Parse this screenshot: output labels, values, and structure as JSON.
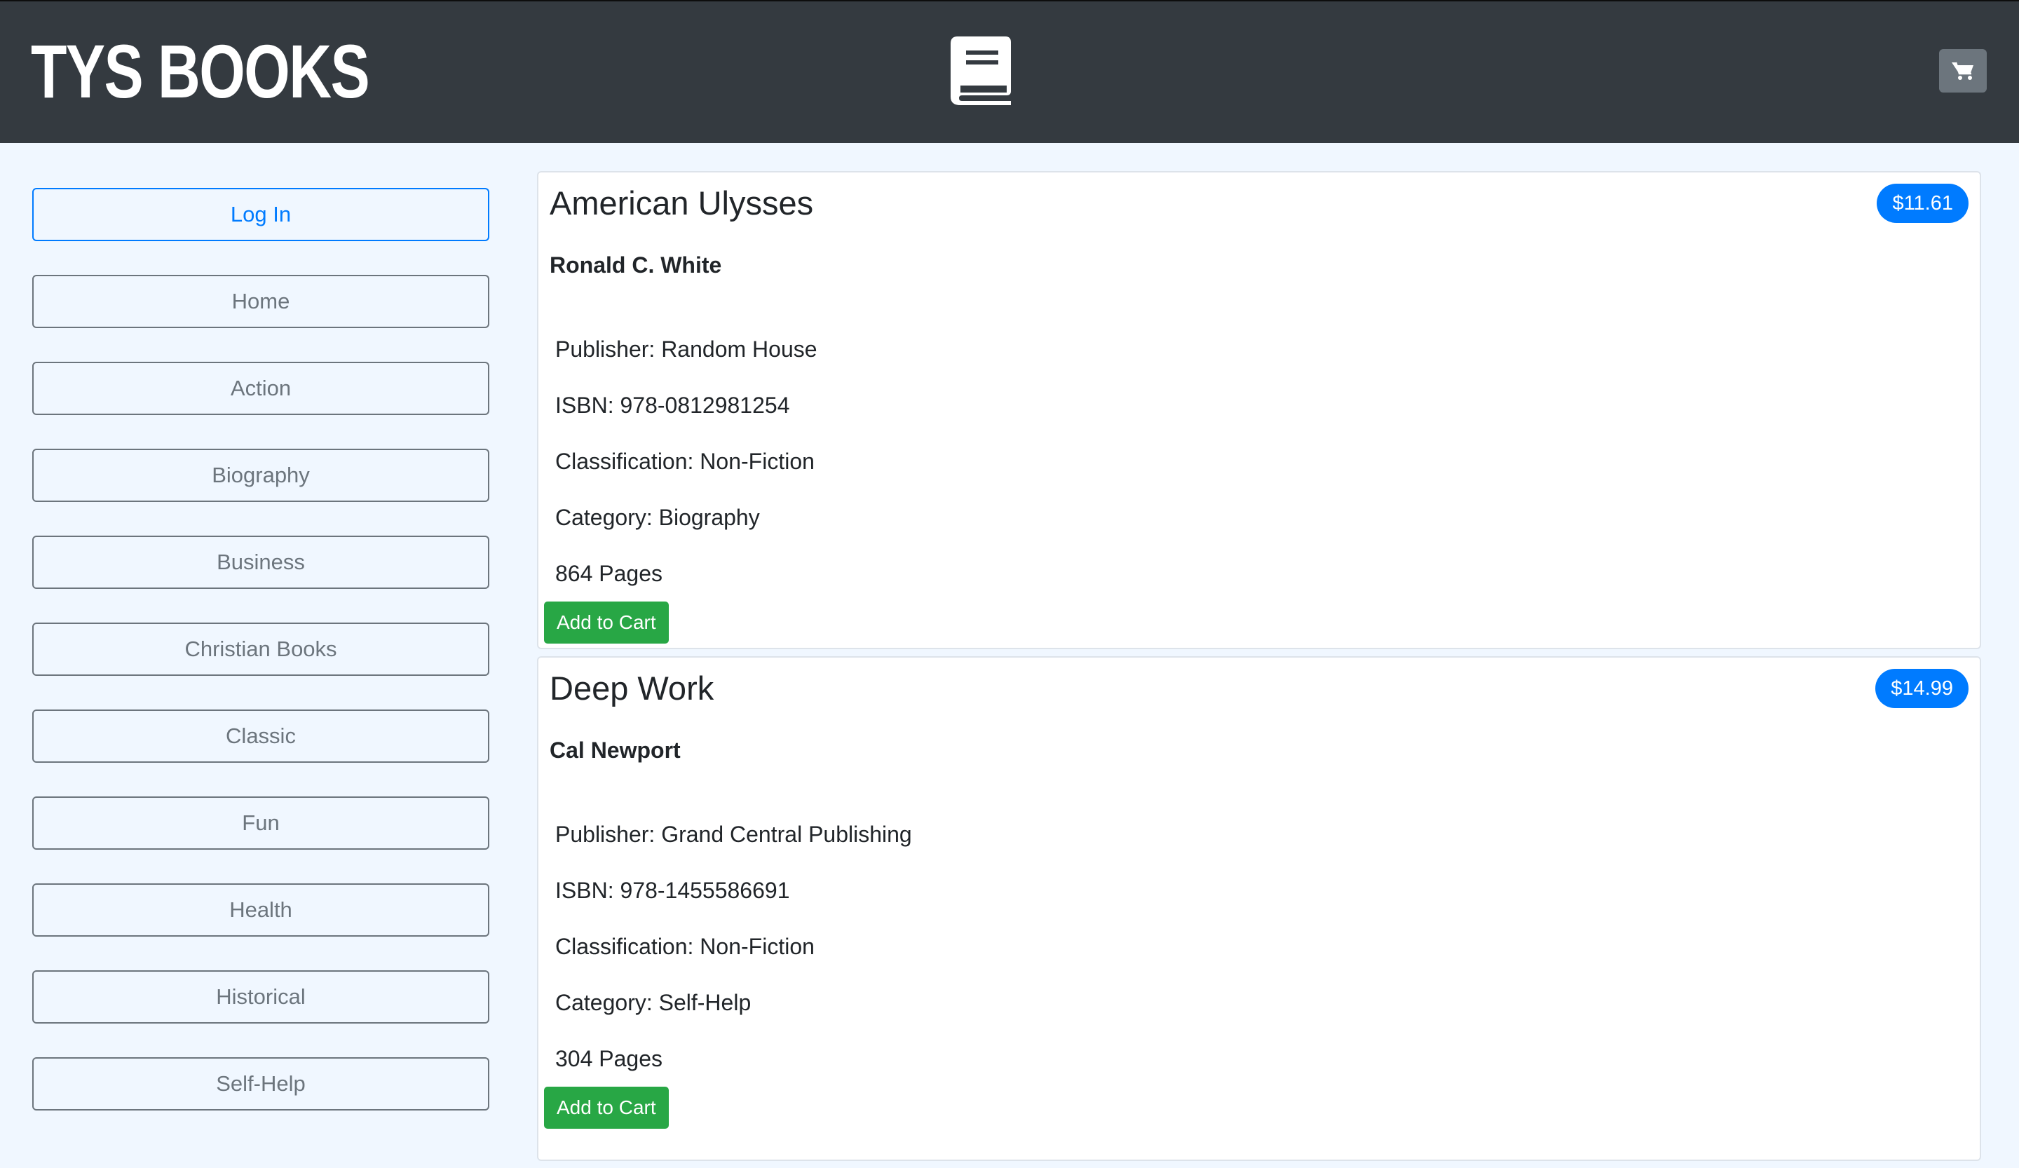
{
  "header": {
    "brand": "TYS BOOKS",
    "center_icon": "book-icon",
    "cart_icon": "shopping-cart-icon"
  },
  "sidebar": {
    "items": [
      {
        "label": "Log In"
      },
      {
        "label": "Home"
      },
      {
        "label": "Action"
      },
      {
        "label": "Biography"
      },
      {
        "label": "Business"
      },
      {
        "label": "Christian Books"
      },
      {
        "label": "Classic"
      },
      {
        "label": "Fun"
      },
      {
        "label": "Health"
      },
      {
        "label": "Historical"
      },
      {
        "label": "Self-Help"
      }
    ]
  },
  "books": [
    {
      "title": "American Ulysses",
      "price": "$11.61",
      "author": "Ronald C. White",
      "publisher": "Publisher: Random House",
      "isbn": "ISBN: 978-0812981254",
      "classification": "Classification: Non-Fiction",
      "category": "Category: Biography",
      "pages": "864 Pages",
      "button": "Add to Cart"
    },
    {
      "title": "Deep Work",
      "price": "$14.99",
      "author": "Cal Newport",
      "publisher": "Publisher: Grand Central Publishing",
      "isbn": "ISBN: 978-1455586691",
      "classification": "Classification: Non-Fiction",
      "category": "Category: Self-Help",
      "pages": "304 Pages",
      "button": "Add to Cart"
    }
  ],
  "colors": {
    "navbar": "#343a40",
    "page_background": "#f0f7ff",
    "primary": "#007bff",
    "secondary": "#6c757d",
    "success": "#28a745"
  }
}
